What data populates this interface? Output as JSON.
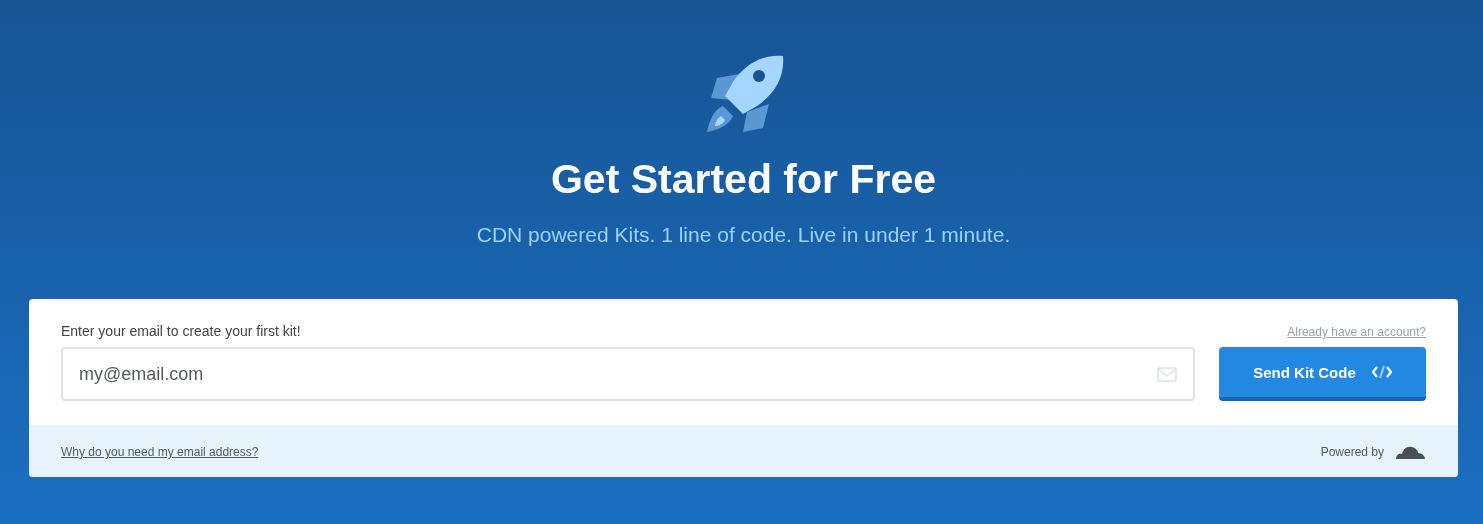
{
  "hero": {
    "title": "Get Started for Free",
    "subtitle": "CDN powered Kits. 1 line of code. Live in under 1 minute."
  },
  "form": {
    "label": "Enter your email to create your first kit!",
    "login_link": "Already have an account?",
    "email_field": {
      "placeholder": "my@email.com"
    },
    "submit_button": "Send Kit Code"
  },
  "footer": {
    "help_link": "Why do you need my email address?",
    "powered_by": "Powered by"
  }
}
